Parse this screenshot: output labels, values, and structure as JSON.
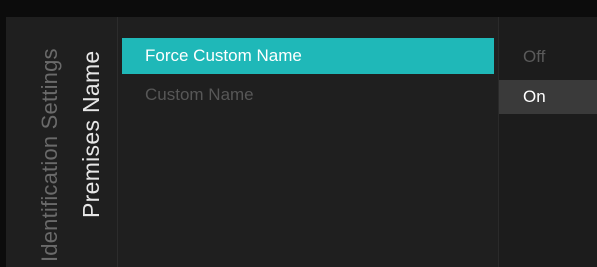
{
  "breadcrumb": {
    "parent": "Identification Settings",
    "current": "Premises Name"
  },
  "menu": {
    "items": [
      {
        "label": "Force Custom Name",
        "state": "selected"
      },
      {
        "label": "Custom Name",
        "state": "disabled"
      }
    ]
  },
  "options": {
    "items": [
      {
        "label": "Off",
        "state": "unselected"
      },
      {
        "label": "On",
        "state": "selected"
      }
    ]
  },
  "colors": {
    "accent": "#1fb8b8",
    "panel": "#1f1f1f",
    "background": "#0c0c0c"
  }
}
